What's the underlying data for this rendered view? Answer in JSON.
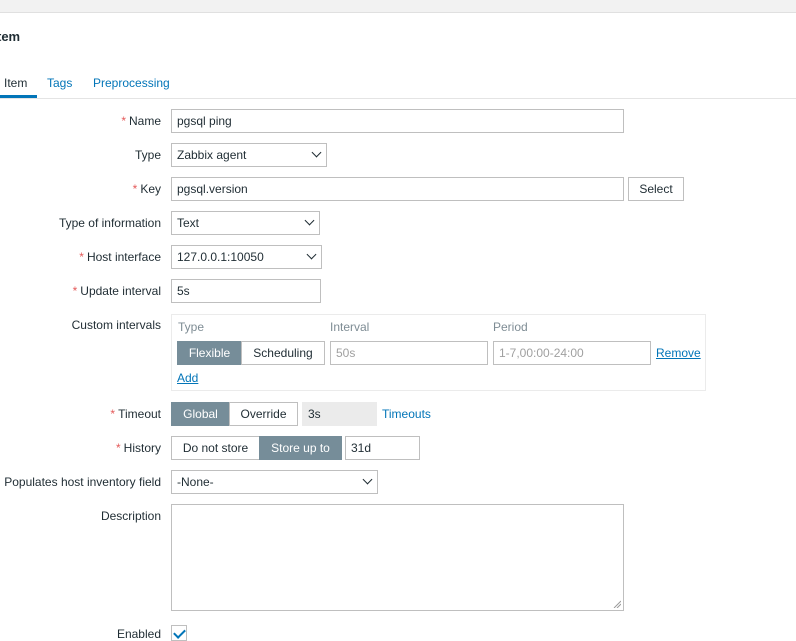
{
  "window": {
    "title": "tem"
  },
  "tabs": [
    {
      "label": "Item",
      "active": true
    },
    {
      "label": "Tags",
      "active": false
    },
    {
      "label": "Preprocessing",
      "active": false
    }
  ],
  "form": {
    "name": {
      "label": "Name",
      "required": true,
      "value": "pgsql ping"
    },
    "type": {
      "label": "Type",
      "value": "Zabbix agent"
    },
    "key": {
      "label": "Key",
      "required": true,
      "value": "pgsql.version",
      "select_label": "Select"
    },
    "type_of_information": {
      "label": "Type of information",
      "value": "Text"
    },
    "host_interface": {
      "label": "Host interface",
      "required": true,
      "value": "127.0.0.1:10050"
    },
    "update_interval": {
      "label": "Update interval",
      "required": true,
      "value": "5s"
    },
    "custom_intervals": {
      "label": "Custom intervals",
      "col_type": "Type",
      "col_interval": "Interval",
      "col_period": "Period",
      "flexible_label": "Flexible",
      "scheduling_label": "Scheduling",
      "selected": "Flexible",
      "interval_placeholder": "50s",
      "period_placeholder": "1-7,00:00-24:00",
      "remove_label": "Remove",
      "add_label": "Add"
    },
    "timeout": {
      "label": "Timeout",
      "required": true,
      "global_label": "Global",
      "override_label": "Override",
      "selected": "Global",
      "value": "3s",
      "timeouts_link": "Timeouts"
    },
    "history": {
      "label": "History",
      "required": true,
      "do_not_store_label": "Do not store",
      "store_up_to_label": "Store up to",
      "selected": "Store up to",
      "value": "31d"
    },
    "inventory": {
      "label": "Populates host inventory field",
      "value": "-None-"
    },
    "description": {
      "label": "Description",
      "value": ""
    },
    "enabled": {
      "label": "Enabled",
      "checked": true
    }
  },
  "colors": {
    "accent": "#0275b8",
    "required": "#e45959",
    "segment_on": "#768d99"
  }
}
